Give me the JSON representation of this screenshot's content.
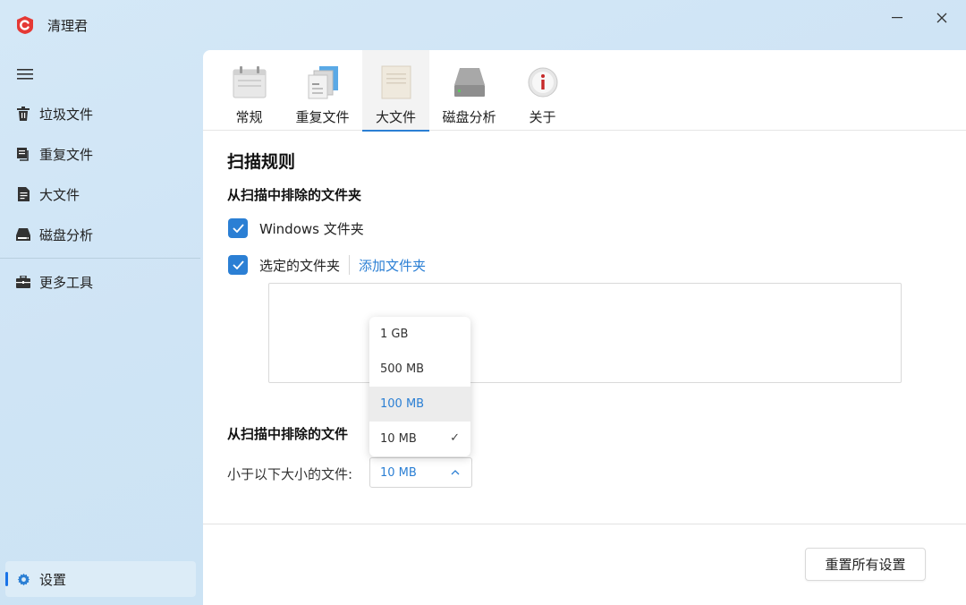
{
  "app": {
    "title": "清理君"
  },
  "sidebar": {
    "items": [
      {
        "label": "垃圾文件",
        "icon": "trash-icon"
      },
      {
        "label": "重复文件",
        "icon": "duplicate-files-icon"
      },
      {
        "label": "大文件",
        "icon": "document-icon"
      },
      {
        "label": "磁盘分析",
        "icon": "disk-icon"
      },
      {
        "label": "更多工具",
        "icon": "toolbox-icon"
      }
    ],
    "settings_label": "设置"
  },
  "tabs": [
    {
      "label": "常规",
      "icon": "calendar-icon"
    },
    {
      "label": "重复文件",
      "icon": "duplicate-docs-icon"
    },
    {
      "label": "大文件",
      "icon": "large-file-icon"
    },
    {
      "label": "磁盘分析",
      "icon": "hard-drive-icon"
    },
    {
      "label": "关于",
      "icon": "info-icon"
    }
  ],
  "active_tab": "大文件",
  "content": {
    "section_title": "扫描规则",
    "excluded_folders_title": "从扫描中排除的文件夹",
    "windows_folder_label": "Windows 文件夹",
    "windows_folder_checked": true,
    "selected_folder_label": "选定的文件夹",
    "selected_folder_checked": true,
    "add_folder_link": "添加文件夹",
    "excluded_files_title": "从扫描中排除的文件",
    "size_label": "小于以下大小的文件:",
    "size_value": "10 MB",
    "size_options": [
      "1 GB",
      "500 MB",
      "100 MB",
      "10 MB"
    ],
    "hovered_option": "100 MB"
  },
  "footer": {
    "reset_label": "重置所有设置"
  },
  "colors": {
    "accent": "#2b7fd4",
    "brand_red": "#e53935"
  }
}
